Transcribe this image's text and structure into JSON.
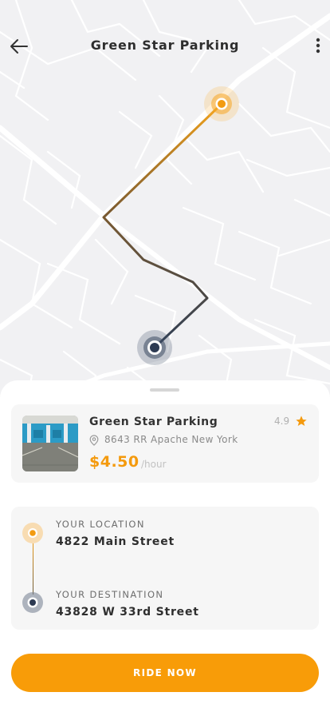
{
  "header": {
    "title": "Green Star Parking"
  },
  "parking": {
    "name": "Green Star Parking",
    "rating": "4.9",
    "address": "8643 RR Apache New York",
    "price": "$4.50",
    "price_unit": "/hour"
  },
  "route": {
    "from_label": "YOUR LOCATION",
    "from_value": "4822 Main Street",
    "to_label": "YOUR DESTINATION",
    "to_value": "43828 W 33rd Street"
  },
  "action": {
    "ride_label": "RIDE NOW"
  },
  "colors": {
    "accent": "#f89c08",
    "route_start": "#e79a1b",
    "route_end": "#3a4558",
    "map_bg": "#f1f1f3"
  },
  "icons": [
    "back-arrow-icon",
    "more-vertical-icon",
    "location-pin-icon",
    "star-icon"
  ]
}
